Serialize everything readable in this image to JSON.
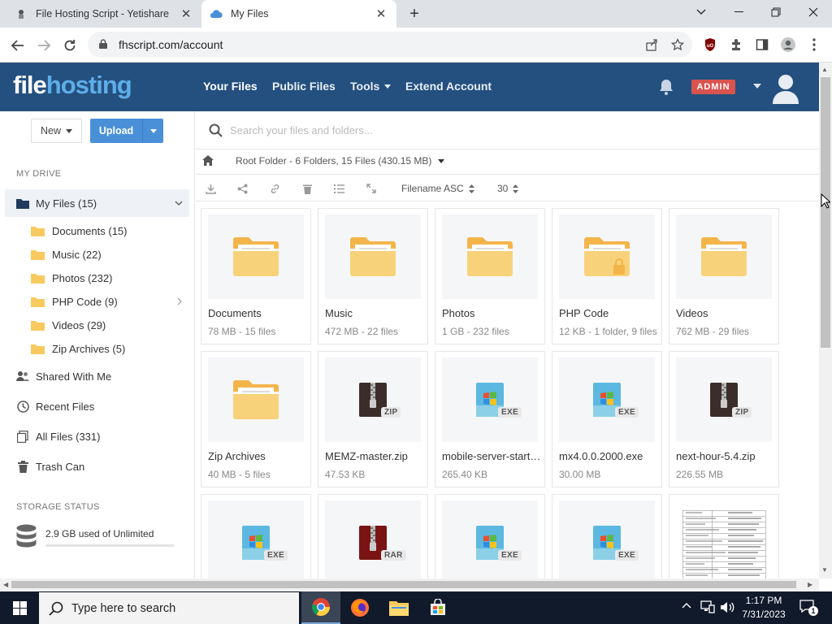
{
  "browser": {
    "tabs": [
      {
        "title": "File Hosting Script - Yetishare",
        "active": false
      },
      {
        "title": "My Files",
        "active": true
      }
    ],
    "url": "fhscript.com/account"
  },
  "header": {
    "logo": {
      "part1": "file",
      "part2": "hosting"
    },
    "nav": [
      "Your Files",
      "Public Files",
      "Tools",
      "Extend Account"
    ],
    "admin_badge": "ADMIN"
  },
  "sidebar": {
    "new_label": "New",
    "upload_label": "Upload",
    "my_drive_heading": "MY DRIVE",
    "my_files_label": "My Files (15)",
    "folders": [
      {
        "label": "Documents (15)"
      },
      {
        "label": "Music (22)"
      },
      {
        "label": "Photos (232)"
      },
      {
        "label": "PHP Code (9)",
        "has_children": true
      },
      {
        "label": "Videos (29)"
      },
      {
        "label": "Zip Archives (5)"
      }
    ],
    "links": [
      {
        "label": "Shared With Me",
        "icon": "users-icon"
      },
      {
        "label": "Recent Files",
        "icon": "clock-icon"
      },
      {
        "label": "All Files (331)",
        "icon": "files-icon"
      },
      {
        "label": "Trash Can",
        "icon": "trash-icon"
      }
    ],
    "storage_heading": "STORAGE STATUS",
    "storage_text": "2.9 GB used of Unlimited",
    "storage_fraction": 0.0
  },
  "main": {
    "search_placeholder": "Search your files and folders...",
    "breadcrumb": "Root Folder - 6 Folders, 15 Files (430.15 MB)",
    "sort_label": "Filename ASC",
    "per_page": "30",
    "items": [
      {
        "name": "Documents",
        "meta": "78 MB - 15 files",
        "type": "folder"
      },
      {
        "name": "Music",
        "meta": "472 MB - 22 files",
        "type": "folder"
      },
      {
        "name": "Photos",
        "meta": "1 GB - 232 files",
        "type": "folder"
      },
      {
        "name": "PHP Code",
        "meta": "12 KB - 1 folder, 9 files",
        "type": "folder-locked"
      },
      {
        "name": "Videos",
        "meta": "762 MB - 29 files",
        "type": "folder"
      },
      {
        "name": "Zip Archives",
        "meta": "40 MB - 5 files",
        "type": "folder"
      },
      {
        "name": "MEMZ-master.zip",
        "meta": "47.53 KB",
        "type": "zip"
      },
      {
        "name": "mobile-server-starter.exe",
        "meta": "265.40 KB",
        "type": "exe"
      },
      {
        "name": "mx4.0.0.2000.exe",
        "meta": "30.00 MB",
        "type": "exe"
      },
      {
        "name": "next-hour-5.4.zip",
        "meta": "226.55 MB",
        "type": "zip"
      },
      {
        "name": "",
        "meta": "",
        "type": "exe"
      },
      {
        "name": "",
        "meta": "",
        "type": "rar"
      },
      {
        "name": "",
        "meta": "",
        "type": "exe"
      },
      {
        "name": "",
        "meta": "",
        "type": "exe"
      },
      {
        "name": "",
        "meta": "",
        "type": "document-preview"
      }
    ],
    "badges": {
      "zip": "ZIP",
      "exe": "EXE",
      "rar": "RAR"
    }
  },
  "taskbar": {
    "search_placeholder": "Type here to search",
    "time": "1:17 PM",
    "date": "7/31/2023",
    "notification_count": "1"
  },
  "colors": {
    "header_bg": "#24507f",
    "logo_accent": "#5eaee8",
    "upload_button": "#4a90d9",
    "admin_badge": "#d9534f",
    "folder": "#f8c95e"
  }
}
